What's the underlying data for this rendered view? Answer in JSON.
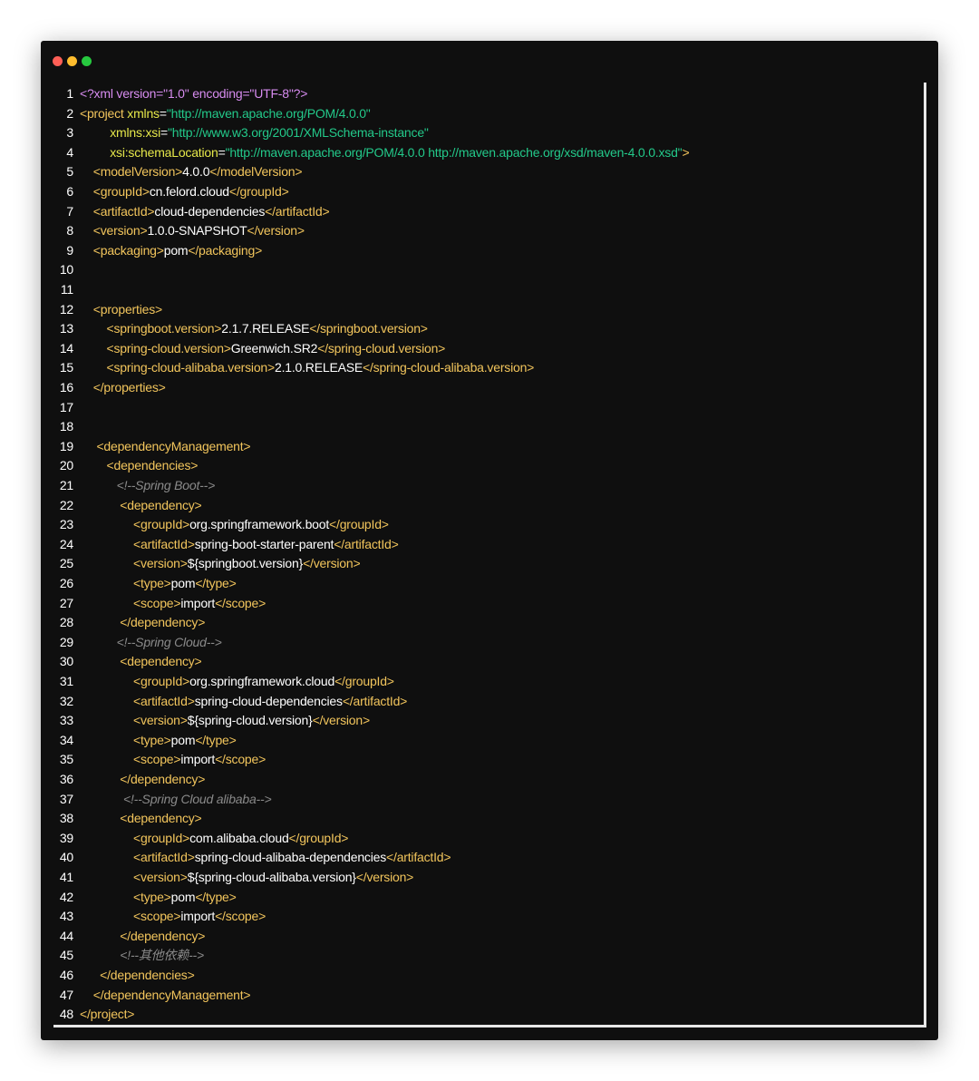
{
  "window": {
    "controls": [
      "close",
      "minimize",
      "maximize"
    ],
    "colors": {
      "close": "#ff5f56",
      "minimize": "#ffbd2e",
      "maximize": "#27c93f",
      "background": "#0f0f0f"
    }
  },
  "code": {
    "language": "xml",
    "lines": [
      {
        "n": "1",
        "indent": "",
        "segs": [
          {
            "t": "<?xml version=\"1.0\" encoding=\"UTF-8\"?>",
            "c": "pi"
          }
        ]
      },
      {
        "n": "2",
        "indent": "",
        "segs": [
          {
            "t": "<project ",
            "c": "tag"
          },
          {
            "t": "xmlns",
            "c": "attr"
          },
          {
            "t": "=",
            "c": "txt"
          },
          {
            "t": "\"http://maven.apache.org/POM/4.0.0\"",
            "c": "val"
          }
        ]
      },
      {
        "n": "3",
        "indent": "         ",
        "segs": [
          {
            "t": "xmlns:xsi",
            "c": "attr"
          },
          {
            "t": "=",
            "c": "txt"
          },
          {
            "t": "\"http://www.w3.org/2001/XMLSchema-instance\"",
            "c": "val"
          }
        ]
      },
      {
        "n": "4",
        "indent": "         ",
        "segs": [
          {
            "t": "xsi:schemaLocation",
            "c": "attr"
          },
          {
            "t": "=",
            "c": "txt"
          },
          {
            "t": "\"http://maven.apache.org/POM/4.0.0 http://maven.apache.org/xsd/maven-4.0.0.xsd\"",
            "c": "val"
          },
          {
            "t": ">",
            "c": "tag"
          }
        ]
      },
      {
        "n": "5",
        "indent": "    ",
        "segs": [
          {
            "t": "<modelVersion>",
            "c": "tag"
          },
          {
            "t": "4.0.0",
            "c": "txt"
          },
          {
            "t": "</modelVersion>",
            "c": "tag"
          }
        ]
      },
      {
        "n": "6",
        "indent": "    ",
        "segs": [
          {
            "t": "<groupId>",
            "c": "tag"
          },
          {
            "t": "cn.felord.cloud",
            "c": "txt"
          },
          {
            "t": "</groupId>",
            "c": "tag"
          }
        ]
      },
      {
        "n": "7",
        "indent": "    ",
        "segs": [
          {
            "t": "<artifactId>",
            "c": "tag"
          },
          {
            "t": "cloud-dependencies",
            "c": "txt"
          },
          {
            "t": "</artifactId>",
            "c": "tag"
          }
        ]
      },
      {
        "n": "8",
        "indent": "    ",
        "segs": [
          {
            "t": "<version>",
            "c": "tag"
          },
          {
            "t": "1.0.0-SNAPSHOT",
            "c": "txt"
          },
          {
            "t": "</version>",
            "c": "tag"
          }
        ]
      },
      {
        "n": "9",
        "indent": "    ",
        "segs": [
          {
            "t": "<packaging>",
            "c": "tag"
          },
          {
            "t": "pom",
            "c": "txt"
          },
          {
            "t": "</packaging>",
            "c": "tag"
          }
        ]
      },
      {
        "n": "10",
        "indent": "",
        "segs": []
      },
      {
        "n": "11",
        "indent": "",
        "segs": []
      },
      {
        "n": "12",
        "indent": "    ",
        "segs": [
          {
            "t": "<properties>",
            "c": "tag"
          }
        ]
      },
      {
        "n": "13",
        "indent": "        ",
        "segs": [
          {
            "t": "<springboot.version>",
            "c": "tag"
          },
          {
            "t": "2.1.7.RELEASE",
            "c": "txt"
          },
          {
            "t": "</springboot.version>",
            "c": "tag"
          }
        ]
      },
      {
        "n": "14",
        "indent": "        ",
        "segs": [
          {
            "t": "<spring-cloud.version>",
            "c": "tag"
          },
          {
            "t": "Greenwich.SR2",
            "c": "txt"
          },
          {
            "t": "</spring-cloud.version>",
            "c": "tag"
          }
        ]
      },
      {
        "n": "15",
        "indent": "        ",
        "segs": [
          {
            "t": "<spring-cloud-alibaba.version>",
            "c": "tag"
          },
          {
            "t": "2.1.0.RELEASE",
            "c": "txt"
          },
          {
            "t": "</spring-cloud-alibaba.version>",
            "c": "tag"
          }
        ]
      },
      {
        "n": "16",
        "indent": "    ",
        "segs": [
          {
            "t": "</properties>",
            "c": "tag"
          }
        ]
      },
      {
        "n": "17",
        "indent": "",
        "segs": []
      },
      {
        "n": "18",
        "indent": "",
        "segs": []
      },
      {
        "n": "19",
        "indent": "     ",
        "segs": [
          {
            "t": "<dependencyManagement>",
            "c": "tag"
          }
        ]
      },
      {
        "n": "20",
        "indent": "        ",
        "segs": [
          {
            "t": "<dependencies>",
            "c": "tag"
          }
        ]
      },
      {
        "n": "21",
        "indent": "           ",
        "segs": [
          {
            "t": "<!--Spring Boot-->",
            "c": "cmt"
          }
        ]
      },
      {
        "n": "22",
        "indent": "            ",
        "segs": [
          {
            "t": "<dependency>",
            "c": "tag"
          }
        ]
      },
      {
        "n": "23",
        "indent": "                ",
        "segs": [
          {
            "t": "<groupId>",
            "c": "tag"
          },
          {
            "t": "org.springframework.boot",
            "c": "txt"
          },
          {
            "t": "</groupId>",
            "c": "tag"
          }
        ]
      },
      {
        "n": "24",
        "indent": "                ",
        "segs": [
          {
            "t": "<artifactId>",
            "c": "tag"
          },
          {
            "t": "spring-boot-starter-parent",
            "c": "txt"
          },
          {
            "t": "</artifactId>",
            "c": "tag"
          }
        ]
      },
      {
        "n": "25",
        "indent": "                ",
        "segs": [
          {
            "t": "<version>",
            "c": "tag"
          },
          {
            "t": "${springboot.version}",
            "c": "txt"
          },
          {
            "t": "</version>",
            "c": "tag"
          }
        ]
      },
      {
        "n": "26",
        "indent": "                ",
        "segs": [
          {
            "t": "<type>",
            "c": "tag"
          },
          {
            "t": "pom",
            "c": "txt"
          },
          {
            "t": "</type>",
            "c": "tag"
          }
        ]
      },
      {
        "n": "27",
        "indent": "                ",
        "segs": [
          {
            "t": "<scope>",
            "c": "tag"
          },
          {
            "t": "import",
            "c": "txt"
          },
          {
            "t": "</scope>",
            "c": "tag"
          }
        ]
      },
      {
        "n": "28",
        "indent": "            ",
        "segs": [
          {
            "t": "</dependency>",
            "c": "tag"
          }
        ]
      },
      {
        "n": "29",
        "indent": "           ",
        "segs": [
          {
            "t": "<!--Spring Cloud-->",
            "c": "cmt"
          }
        ]
      },
      {
        "n": "30",
        "indent": "            ",
        "segs": [
          {
            "t": "<dependency>",
            "c": "tag"
          }
        ]
      },
      {
        "n": "31",
        "indent": "                ",
        "segs": [
          {
            "t": "<groupId>",
            "c": "tag"
          },
          {
            "t": "org.springframework.cloud",
            "c": "txt"
          },
          {
            "t": "</groupId>",
            "c": "tag"
          }
        ]
      },
      {
        "n": "32",
        "indent": "                ",
        "segs": [
          {
            "t": "<artifactId>",
            "c": "tag"
          },
          {
            "t": "spring-cloud-dependencies",
            "c": "txt"
          },
          {
            "t": "</artifactId>",
            "c": "tag"
          }
        ]
      },
      {
        "n": "33",
        "indent": "                ",
        "segs": [
          {
            "t": "<version>",
            "c": "tag"
          },
          {
            "t": "${spring-cloud.version}",
            "c": "txt"
          },
          {
            "t": "</version>",
            "c": "tag"
          }
        ]
      },
      {
        "n": "34",
        "indent": "                ",
        "segs": [
          {
            "t": "<type>",
            "c": "tag"
          },
          {
            "t": "pom",
            "c": "txt"
          },
          {
            "t": "</type>",
            "c": "tag"
          }
        ]
      },
      {
        "n": "35",
        "indent": "                ",
        "segs": [
          {
            "t": "<scope>",
            "c": "tag"
          },
          {
            "t": "import",
            "c": "txt"
          },
          {
            "t": "</scope>",
            "c": "tag"
          }
        ]
      },
      {
        "n": "36",
        "indent": "            ",
        "segs": [
          {
            "t": "</dependency>",
            "c": "tag"
          }
        ]
      },
      {
        "n": "37",
        "indent": "             ",
        "segs": [
          {
            "t": "<!--Spring Cloud alibaba-->",
            "c": "cmt"
          }
        ]
      },
      {
        "n": "38",
        "indent": "            ",
        "segs": [
          {
            "t": "<dependency>",
            "c": "tag"
          }
        ]
      },
      {
        "n": "39",
        "indent": "                ",
        "segs": [
          {
            "t": "<groupId>",
            "c": "tag"
          },
          {
            "t": "com.alibaba.cloud",
            "c": "txt"
          },
          {
            "t": "</groupId>",
            "c": "tag"
          }
        ]
      },
      {
        "n": "40",
        "indent": "                ",
        "segs": [
          {
            "t": "<artifactId>",
            "c": "tag"
          },
          {
            "t": "spring-cloud-alibaba-dependencies",
            "c": "txt"
          },
          {
            "t": "</artifactId>",
            "c": "tag"
          }
        ]
      },
      {
        "n": "41",
        "indent": "                ",
        "segs": [
          {
            "t": "<version>",
            "c": "tag"
          },
          {
            "t": "${spring-cloud-alibaba.version}",
            "c": "txt"
          },
          {
            "t": "</version>",
            "c": "tag"
          }
        ]
      },
      {
        "n": "42",
        "indent": "                ",
        "segs": [
          {
            "t": "<type>",
            "c": "tag"
          },
          {
            "t": "pom",
            "c": "txt"
          },
          {
            "t": "</type>",
            "c": "tag"
          }
        ]
      },
      {
        "n": "43",
        "indent": "                ",
        "segs": [
          {
            "t": "<scope>",
            "c": "tag"
          },
          {
            "t": "import",
            "c": "txt"
          },
          {
            "t": "</scope>",
            "c": "tag"
          }
        ]
      },
      {
        "n": "44",
        "indent": "            ",
        "segs": [
          {
            "t": "</dependency>",
            "c": "tag"
          }
        ]
      },
      {
        "n": "45",
        "indent": "            ",
        "segs": [
          {
            "t": "<!--其他依赖-->",
            "c": "cmt"
          }
        ]
      },
      {
        "n": "46",
        "indent": "      ",
        "segs": [
          {
            "t": "</dependencies>",
            "c": "tag"
          }
        ]
      },
      {
        "n": "47",
        "indent": "    ",
        "segs": [
          {
            "t": "</dependencyManagement>",
            "c": "tag"
          }
        ]
      },
      {
        "n": "48",
        "indent": "",
        "segs": [
          {
            "t": "</project>",
            "c": "tag"
          }
        ]
      }
    ]
  }
}
